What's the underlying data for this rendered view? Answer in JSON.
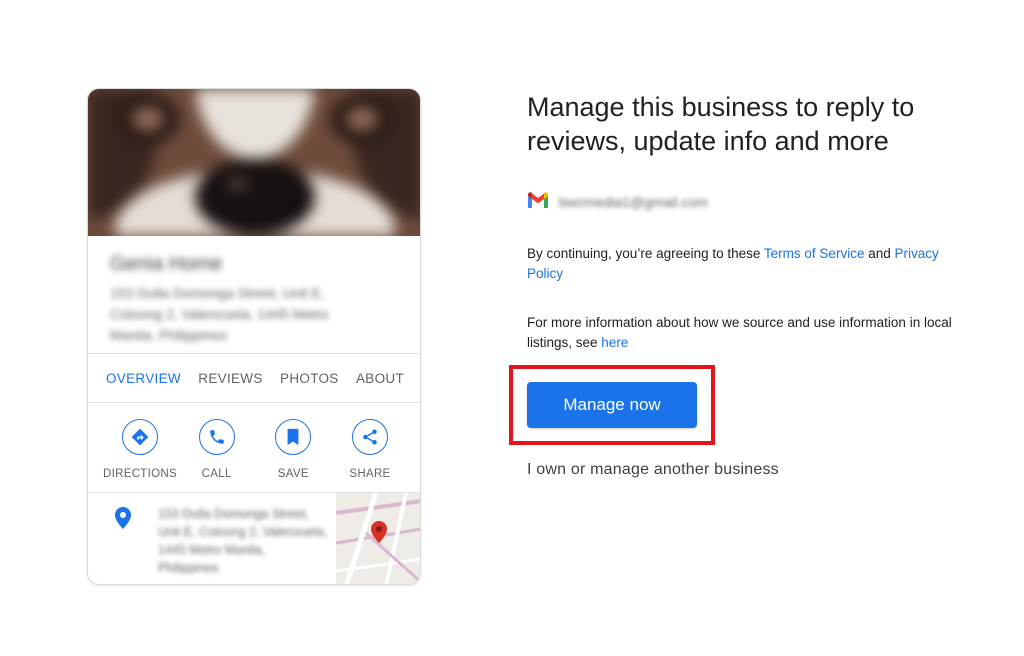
{
  "card": {
    "name": "Genia Home",
    "address": "153 Dulla Domonga Street, Unit E, Coloong 2, Valenzuela, 1445 Metro Manila, Philippines",
    "tabs": [
      {
        "label": "OVERVIEW",
        "active": true
      },
      {
        "label": "REVIEWS",
        "active": false
      },
      {
        "label": "PHOTOS",
        "active": false
      },
      {
        "label": "ABOUT",
        "active": false
      }
    ],
    "actions": [
      {
        "label": "DIRECTIONS",
        "icon": "directions-icon"
      },
      {
        "label": "CALL",
        "icon": "phone-icon"
      },
      {
        "label": "SAVE",
        "icon": "bookmark-icon"
      },
      {
        "label": "SHARE",
        "icon": "share-icon"
      }
    ],
    "location_text": "153 Dulla Domonga Street, Unit E, Coloong 2, Valenzuela, 1445 Metro Manila, Philippines"
  },
  "panel": {
    "heading": "Manage this business to reply to reviews, update info and more",
    "account_email": "bwcmedia1@gmail.com",
    "consent_prefix": "By continuing, you’re agreeing to these ",
    "terms_link": "Terms of Service",
    "consent_and": " and ",
    "privacy_link": "Privacy Policy",
    "info_prefix": "For more information about how we source and use information in local listings, see ",
    "here_link": "here",
    "manage_button": "Manage now",
    "other_business_link": "I own or manage another business"
  },
  "colors": {
    "accent": "#1a73e8",
    "highlight": "#e3141b",
    "map_pin": "#d93025"
  }
}
